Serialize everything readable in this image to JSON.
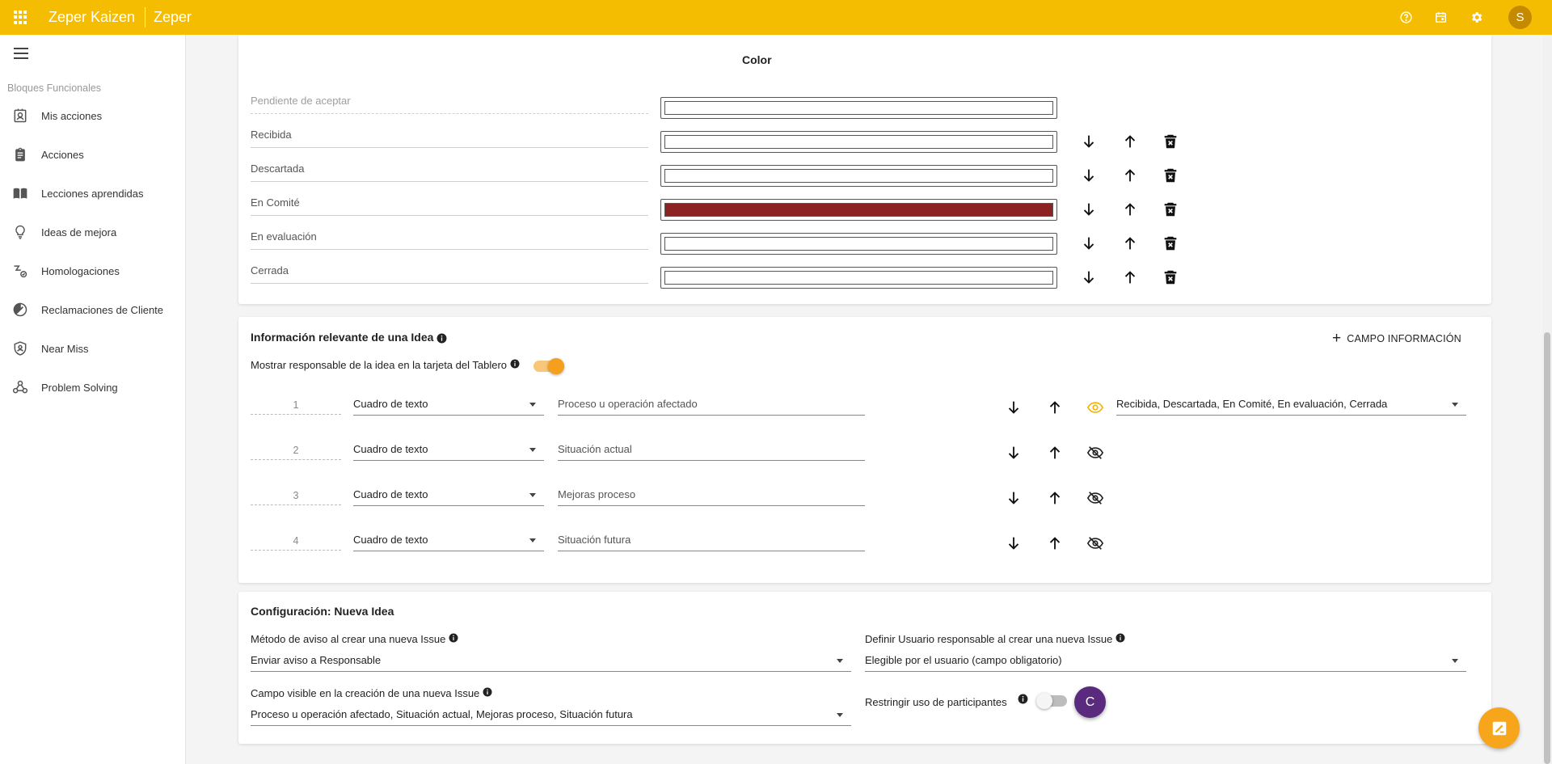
{
  "header": {
    "app_name": "Zeper Kaizen",
    "company": "Zeper",
    "avatar_initial": "S",
    "accent_color": "#f5bd02"
  },
  "sidebar": {
    "heading": "Bloques Funcionales",
    "items": [
      {
        "label": "Mis acciones",
        "icon": "contact-badge-icon"
      },
      {
        "label": "Acciones",
        "icon": "clipboard-icon"
      },
      {
        "label": "Lecciones aprendidas",
        "icon": "book-icon"
      },
      {
        "label": "Ideas de mejora",
        "icon": "lightbulb-icon"
      },
      {
        "label": "Homologaciones",
        "icon": "approval-flow-icon"
      },
      {
        "label": "Reclamaciones de Cliente",
        "icon": "report-icon"
      },
      {
        "label": "Near Miss",
        "icon": "shield-person-icon"
      },
      {
        "label": "Problem Solving",
        "icon": "network-icon"
      }
    ]
  },
  "states_section": {
    "color_header": "Color",
    "states": [
      {
        "label": "Pendiente de aceptar",
        "color": "#ffffff"
      },
      {
        "label": "Recibida",
        "color": "#ffffff"
      },
      {
        "label": "Descartada",
        "color": "#ffffff"
      },
      {
        "label": "En Comité",
        "color": "#8b2323"
      },
      {
        "label": "En evaluación",
        "color": "#ffffff"
      },
      {
        "label": "Cerrada",
        "color": "#ffffff"
      }
    ]
  },
  "info_section": {
    "title": "Información relevante de una Idea",
    "add_button": "CAMPO INFORMACIÓN",
    "toggle_label": "Mostrar responsable de la idea en la tarjeta del Tablero",
    "toggle_on": true,
    "rows": [
      {
        "num": "1",
        "type": "Cuadro de texto",
        "name": "Proceso u operación afectado",
        "visible": true,
        "visible_states": "Recibida, Descartada, En Comité, En evaluación, Cerrada"
      },
      {
        "num": "2",
        "type": "Cuadro de texto",
        "name": "Situación actual",
        "visible": false
      },
      {
        "num": "3",
        "type": "Cuadro de texto",
        "name": "Mejoras proceso",
        "visible": false
      },
      {
        "num": "4",
        "type": "Cuadro de texto",
        "name": "Situación futura",
        "visible": false
      }
    ]
  },
  "config_section": {
    "title": "Configuración: Nueva Idea",
    "notify_label": "Método de aviso al crear una nueva Issue",
    "notify_value": "Enviar aviso a Responsable",
    "responsible_label": "Definir Usuario responsable al crear una nueva Issue",
    "responsible_value": "Elegible por el usuario (campo obligatorio)",
    "visible_field_label": "Campo visible en la creación de una nueva Issue",
    "visible_field_value": "Proceso u operación afectado, Situación actual, Mejoras proceso, Situación futura",
    "restrict_label": "Restringir uso de participantes",
    "restrict_on": false,
    "bubble_initial": "C"
  }
}
